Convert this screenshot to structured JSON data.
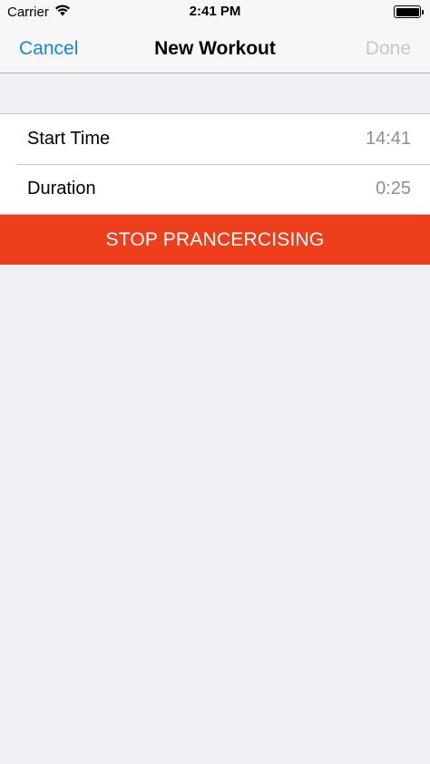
{
  "status_bar": {
    "carrier": "Carrier",
    "time": "2:41 PM",
    "battery_level": 1.0
  },
  "nav": {
    "cancel_label": "Cancel",
    "title": "New Workout",
    "done_label": "Done"
  },
  "table": {
    "rows": [
      {
        "label": "Start Time",
        "value": "14:41"
      },
      {
        "label": "Duration",
        "value": "0:25"
      }
    ]
  },
  "actions": {
    "stop_label": "STOP PRANCERCISING"
  },
  "colors": {
    "accent": "#1A82E6",
    "stop_button": "#EE3E1C",
    "disabled": "#C8C8CC",
    "background": "#EFEFF4"
  }
}
